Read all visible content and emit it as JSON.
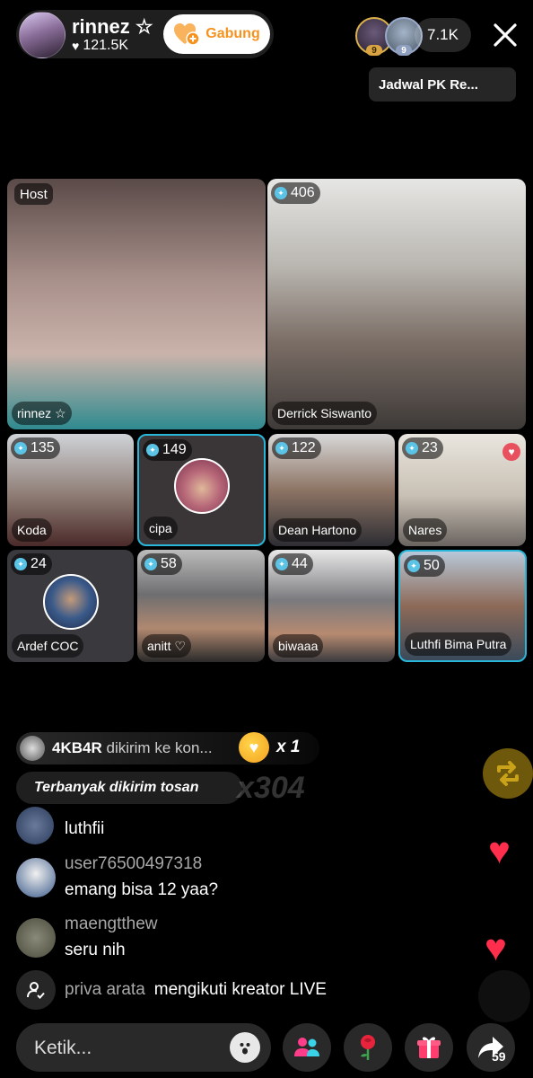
{
  "header": {
    "host_name": "rinnez ☆",
    "host_likes": "121.5K",
    "join_label": "Gabung",
    "top_viewer_badges": [
      "9",
      "9"
    ],
    "viewer_count": "7.1K",
    "pk_schedule": "Jadwal PK Re..."
  },
  "grid": {
    "host_tag": "Host",
    "participants": [
      {
        "name": "rinnez ☆",
        "score": ""
      },
      {
        "name": "Derrick Siswanto",
        "score": "406"
      },
      {
        "name": "Koda",
        "score": "135"
      },
      {
        "name": "cipa",
        "score": "149"
      },
      {
        "name": "Dean Hartono",
        "score": "122"
      },
      {
        "name": "Nares",
        "score": "23"
      },
      {
        "name": "Ardef COC",
        "score": "24"
      },
      {
        "name": "anitt ♡",
        "score": "58"
      },
      {
        "name": "biwaaa",
        "score": "44"
      },
      {
        "name": "Luthfi Bima Putra",
        "score": "50"
      }
    ]
  },
  "chat": {
    "gift_banner": {
      "sender": "4KB4R",
      "text": "dikirim ke kon...",
      "count": "x 1"
    },
    "ghost_text": "x304",
    "top_sender": "Terbanyak dikirim tosan",
    "comments": [
      {
        "user": "",
        "message": "luthfii"
      },
      {
        "user": "user76500497318",
        "message": "emang bisa 12 yaa?"
      },
      {
        "user": "maengtthew",
        "message": "seru nih"
      }
    ],
    "follow_event": {
      "user": "priva arata",
      "text": "mengikuti kreator LIVE"
    }
  },
  "bottom_bar": {
    "input_placeholder": "Ketik...",
    "share_count": "59"
  },
  "colors": {
    "accent_orange": "#f6921e",
    "selected_tile_border": "#29b6d9",
    "heart_red": "#ff2e4c"
  }
}
